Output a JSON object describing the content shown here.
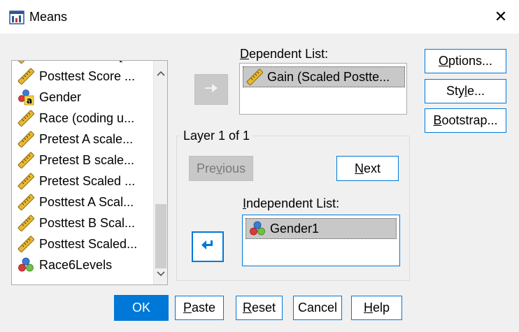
{
  "window": {
    "title": "Means",
    "close_glyph": "✕"
  },
  "source_list": {
    "items": [
      {
        "label": "Pretest Score [...",
        "icon": "scale-ruler-icon"
      },
      {
        "label": "Posttest Score ...",
        "icon": "scale-ruler-icon"
      },
      {
        "label": "Gender",
        "icon": "nominal-string-icon"
      },
      {
        "label": "Race (coding u...",
        "icon": "scale-ruler-icon"
      },
      {
        "label": "Pretest A scale...",
        "icon": "scale-ruler-icon"
      },
      {
        "label": "Pretest B scale...",
        "icon": "scale-ruler-icon"
      },
      {
        "label": "Pretest Scaled ...",
        "icon": "scale-ruler-icon"
      },
      {
        "label": "Posttest A Scal...",
        "icon": "scale-ruler-icon"
      },
      {
        "label": "Posttest B Scal...",
        "icon": "scale-ruler-icon"
      },
      {
        "label": "Posttest Scaled...",
        "icon": "scale-ruler-icon"
      },
      {
        "label": "Race6Levels",
        "icon": "nominal-icon"
      }
    ]
  },
  "dependent": {
    "label_prefix": "D",
    "label_rest": "ependent List:",
    "items": [
      {
        "label": "Gain (Scaled Postte...",
        "icon": "scale-ruler-icon"
      }
    ]
  },
  "layer": {
    "title": "Layer 1 of 1",
    "previous_a": "Pre",
    "previous_u": "v",
    "previous_b": "ious",
    "next_u": "N",
    "next_rest": "ext"
  },
  "independent": {
    "label_prefix": "I",
    "label_rest": "ndependent List:",
    "items": [
      {
        "label": "Gender1",
        "icon": "nominal-icon"
      }
    ]
  },
  "side_buttons": {
    "options_u": "O",
    "options_rest": "ptions...",
    "style_a": "Sty",
    "style_u": "l",
    "style_b": "e...",
    "bootstrap_u": "B",
    "bootstrap_rest": "ootstrap..."
  },
  "bottom_buttons": {
    "ok": "OK",
    "paste_u": "P",
    "paste_rest": "aste",
    "reset_u": "R",
    "reset_rest": "eset",
    "cancel": "Cancel",
    "help_u": "H",
    "help_rest": "elp"
  },
  "colors": {
    "accent": "#0078d7",
    "selection": "#c8c8c8"
  }
}
